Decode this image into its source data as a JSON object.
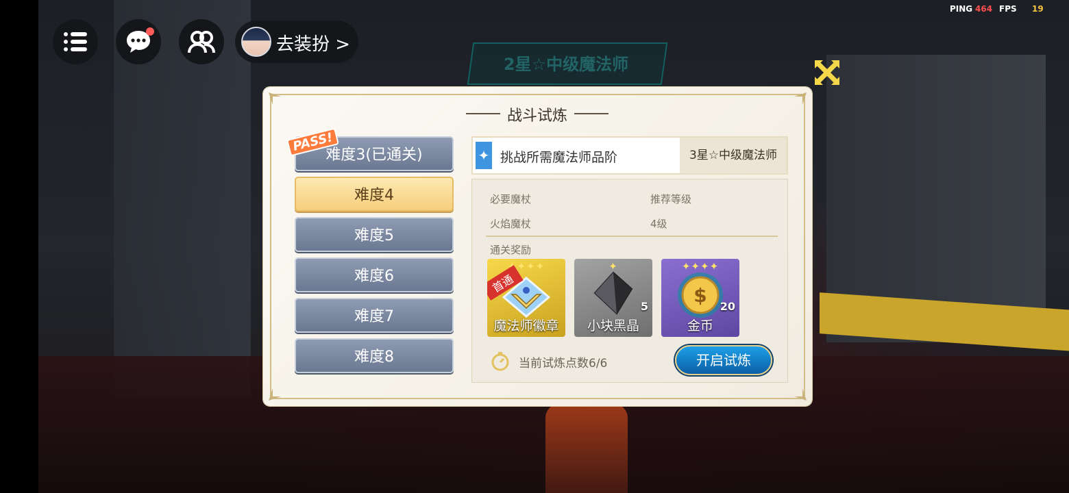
{
  "hud": {
    "menu_icon": "list-icon",
    "chat_icon": "chat-bubble-icon",
    "friends_icon": "friends-icon",
    "dress_up_label": "去装扮 >",
    "ping_label": "PING",
    "ping_value": "464",
    "fps_label": "FPS",
    "fps_value": "19"
  },
  "scene": {
    "banner_text": "2星☆中级魔法师"
  },
  "dialog": {
    "title": "战斗试炼",
    "close_icon": "close-x-icon",
    "difficulties": [
      {
        "label": "难度3(已通关)",
        "passed": true
      },
      {
        "label": "难度4",
        "selected": true
      },
      {
        "label": "难度5"
      },
      {
        "label": "难度6"
      },
      {
        "label": "难度7"
      },
      {
        "label": "难度8"
      }
    ],
    "pass_badge": "PASS!",
    "requirement": {
      "label": "挑战所需魔法师品阶",
      "value": "3星☆中级魔法师"
    },
    "info": {
      "wand_label": "必要魔杖",
      "wand_value": "火焰魔杖",
      "level_label": "推荐等级",
      "level_value": "4级",
      "rewards_label": "通关奖励"
    },
    "rewards": [
      {
        "name": "魔法师徽章",
        "stars": "✦✦✦✦",
        "tag": "首通"
      },
      {
        "name": "小块黑晶",
        "stars": "✦",
        "count": "5"
      },
      {
        "name": "金币",
        "stars": "✦✦✦✦",
        "count": "20"
      }
    ],
    "points_text": "当前试炼点数6/6",
    "start_button": "开启试炼"
  },
  "colors": {
    "selected_difficulty": "#f6cf7d",
    "difficulty": "#7d8aa2",
    "accent_blue": "#1d9fe8",
    "gold_frame": "#d2bd86",
    "ping_color": "#ff5050",
    "fps_color": "#f5c542"
  }
}
